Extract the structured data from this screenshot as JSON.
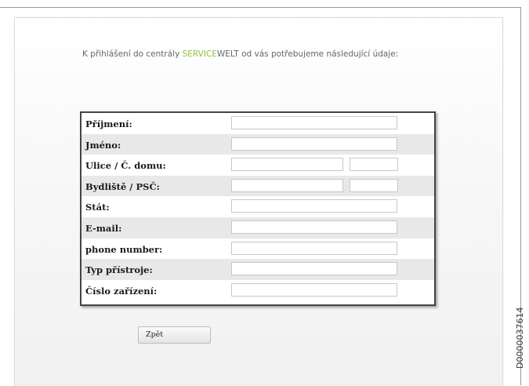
{
  "intro": {
    "prefix": "K přihlášení do centrály ",
    "brand_part1": "SERVICE",
    "brand_part2": "WELT",
    "suffix": " od vás potřebujeme následující údaje:"
  },
  "form": {
    "fields": [
      {
        "label": "Příjmení:",
        "value": ""
      },
      {
        "label": "Jméno:",
        "value": ""
      },
      {
        "label": "Ulice / Č. domu:",
        "value": "",
        "value2": ""
      },
      {
        "label": "Bydliště / PSČ:",
        "value": "",
        "value2": ""
      },
      {
        "label": "Stát:",
        "value": ""
      },
      {
        "label": "E-mail:",
        "value": ""
      },
      {
        "label": "phone number:",
        "value": ""
      },
      {
        "label": "Typ přístroje:",
        "value": ""
      },
      {
        "label": "Číslo zařízení:",
        "value": ""
      }
    ]
  },
  "buttons": {
    "back_label": "Zpět"
  },
  "doc_code": "D0000037614",
  "colors": {
    "brand_green": "#8fbf3a",
    "form_border": "#444444",
    "row_alt": "#e8e8e8"
  }
}
